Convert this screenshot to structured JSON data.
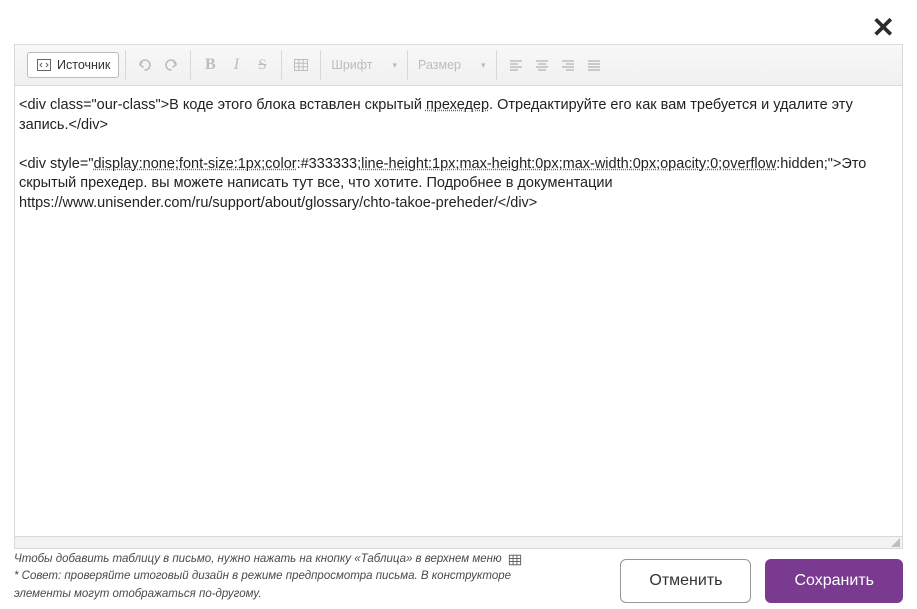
{
  "toolbar": {
    "source_label": "Источник",
    "font_label": "Шрифт",
    "size_label": "Размер"
  },
  "editor": {
    "content_html": "<div class=\"our-class\">В коде этого блока вставлен скрытый <span class=\"underlined\">прехедер</span>. Отредактируйте его как вам требуется и удалите эту запись.</div><br><br><div style=\"<span class=\"underlined\">display:none;font-size:1px;color</span>:#333333;<span class=\"underlined\">line-height:1px;max-height:0px;max-width:0px;opacity:0;overflow</span>:hidden;\">Это скрытый прехедер. вы можете написать тут все, что хотите. Подробнее в документации https://www.unisender.com/ru/support/about/glossary/chto-takoe-preheder/</div>"
  },
  "hints": {
    "line1": "Чтобы добавить таблицу в письмо, нужно нажать на кнопку «Таблица» в верхнем меню",
    "line2": "* Совет: проверяйте итоговый дизайн в режиме предпросмотра письма. В конструкторе элементы могут отображаться по-другому."
  },
  "buttons": {
    "cancel": "Отменить",
    "save": "Сохранить"
  },
  "icons": {
    "close": "close-icon",
    "source": "source-code-icon",
    "undo": "undo-icon",
    "redo": "redo-icon",
    "bold": "bold-icon",
    "italic": "italic-icon",
    "strike": "strikethrough-icon",
    "table": "table-icon",
    "align_left": "align-left-icon",
    "align_center": "align-center-icon",
    "align_right": "align-right-icon",
    "align_justify": "align-justify-icon"
  }
}
